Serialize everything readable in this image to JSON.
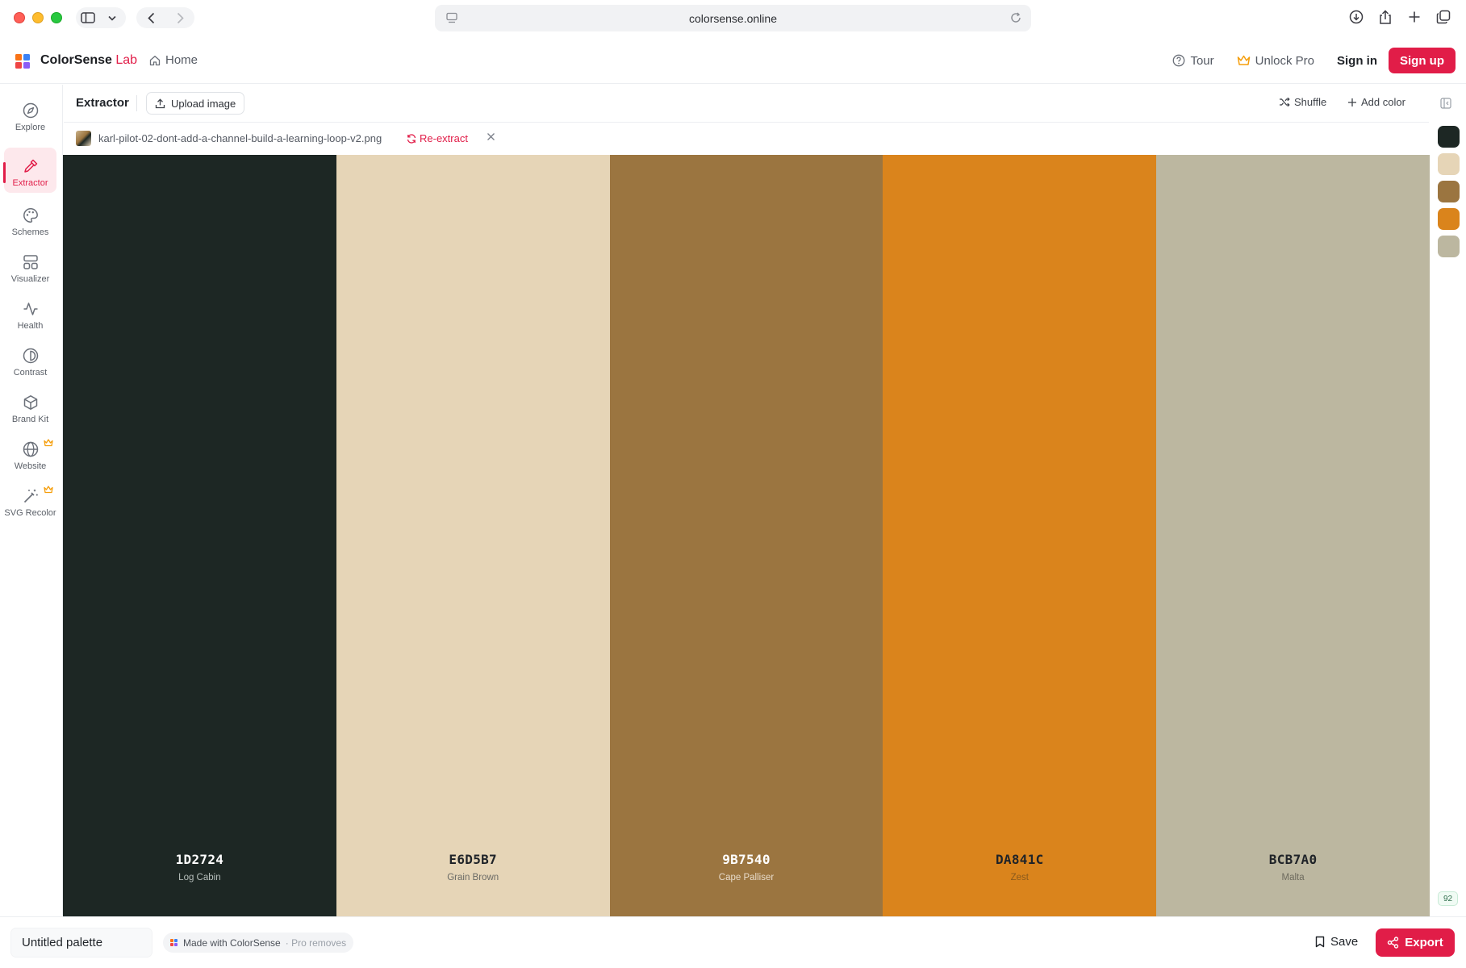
{
  "browser": {
    "url": "colorsense.online"
  },
  "header": {
    "brand_name": "ColorSense",
    "brand_suffix": "Lab",
    "home_label": "Home",
    "tour_label": "Tour",
    "unlock_label": "Unlock Pro",
    "signin_label": "Sign in",
    "signup_label": "Sign up",
    "logo_colors": [
      "#f97316",
      "#3b82f6",
      "#ef4444",
      "#8b5cf6"
    ]
  },
  "sidebar": {
    "items": [
      {
        "label": "Explore",
        "icon": "compass-icon"
      },
      {
        "label": "Extractor",
        "icon": "eyedropper-icon",
        "active": true
      },
      {
        "label": "Schemes",
        "icon": "palette-icon"
      },
      {
        "label": "Visualizer",
        "icon": "layout-icon"
      },
      {
        "label": "Health",
        "icon": "activity-icon"
      },
      {
        "label": "Contrast",
        "icon": "contrast-icon"
      },
      {
        "label": "Brand Kit",
        "icon": "package-icon"
      },
      {
        "label": "Website",
        "icon": "globe-icon",
        "pro": true
      },
      {
        "label": "SVG Recolor",
        "icon": "wand-icon",
        "pro": true
      }
    ]
  },
  "toolbar": {
    "title": "Extractor",
    "upload_label": "Upload image",
    "shuffle_label": "Shuffle",
    "add_color_label": "Add color"
  },
  "file": {
    "name": "karl-pilot-02-dont-add-a-channel-build-a-learning-loop-v2.png",
    "reextract_label": "Re-extract"
  },
  "palette": {
    "colors": [
      {
        "hex": "1D2724",
        "name": "Log Cabin",
        "bg": "#1D2724",
        "text": "#ffffff",
        "sub": "#b7bfbc"
      },
      {
        "hex": "E6D5B7",
        "name": "Grain Brown",
        "bg": "#E6D5B7",
        "text": "#1f2328",
        "sub": "#6b6b66"
      },
      {
        "hex": "9B7540",
        "name": "Cape Palliser",
        "bg": "#9B7540",
        "text": "#ffffff",
        "sub": "#e8dccb"
      },
      {
        "hex": "DA841C",
        "name": "Zest",
        "bg": "#DA841C",
        "text": "#1f2328",
        "sub": "#8a5a1c"
      },
      {
        "hex": "BCB7A0",
        "name": "Malta",
        "bg": "#BCB7A0",
        "text": "#1f2328",
        "sub": "#6e6b5e"
      }
    ]
  },
  "rail": {
    "score": "92"
  },
  "bottom": {
    "palette_name": "Untitled palette",
    "made_with_label": "Made with ColorSense",
    "pro_removes_label": "· Pro removes",
    "save_label": "Save",
    "export_label": "Export"
  },
  "accent_color": "#e11d48"
}
